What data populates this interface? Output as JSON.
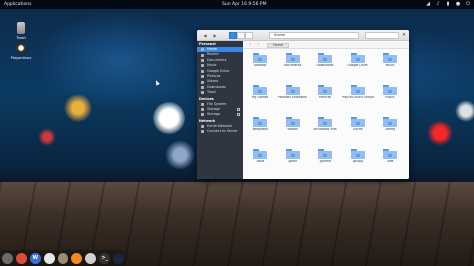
{
  "panel": {
    "applications_label": "Applications",
    "clock": "Sun Apr 16     9:56 PM"
  },
  "desktop_icons": [
    {
      "label": "Trash",
      "icon": "trash-icon"
    },
    {
      "label": "Playonlinux",
      "icon": "playonlinux-icon"
    }
  ],
  "window": {
    "location": "/home",
    "search_placeholder": "",
    "breadcrumb": "Home",
    "sidebar": {
      "personal_header": "Personal",
      "personal_items": [
        "Home",
        "Recent",
        "Documents",
        "Music",
        "Google Drive",
        "Pictures",
        "Videos",
        "Downloads",
        "Trash"
      ],
      "devices_header": "Devices",
      "device_items": [
        "File System",
        "Storage",
        "Storage"
      ],
      "network_header": "Network",
      "network_items": [
        "Entire Network",
        "Connect to Server"
      ]
    },
    "files": [
      "Desktop",
      "Documents",
      "Downloads",
      "Google Drive",
      "Music",
      "My Games",
      "Parallels Extension",
      "Pictures",
      "PlayOnLinux's virtual drives",
      "Public",
      "Templates",
      "Videos",
      "VirtualBox VMs",
      ".cache",
      ".config",
      ".dbus",
      ".gconf",
      ".gnome",
      ".gnupg",
      ".kde"
    ]
  },
  "dock_apps": [
    {
      "name": "settings-app-icon",
      "color": "#6b6b6b",
      "glyph": ""
    },
    {
      "name": "chrome-app-icon",
      "color": "#dd4b39",
      "glyph": ""
    },
    {
      "name": "web-app-icon",
      "color": "#3b6fd6",
      "glyph": "W"
    },
    {
      "name": "files-app-icon",
      "color": "#e8e8e8",
      "glyph": ""
    },
    {
      "name": "gimp-app-icon",
      "color": "#9c8b6e",
      "glyph": ""
    },
    {
      "name": "vlc-app-icon",
      "color": "#f08a24",
      "glyph": ""
    },
    {
      "name": "chromium-app-icon",
      "color": "#d0d0d0",
      "glyph": ""
    },
    {
      "name": "terminal-app-icon",
      "color": "#333333",
      "glyph": ">_"
    },
    {
      "name": "steam-app-icon",
      "color": "#1b2838",
      "glyph": ""
    }
  ],
  "colors": {
    "accent": "#3689e6",
    "sidebar_bg": "#303641",
    "folder": "#8fbfee"
  }
}
